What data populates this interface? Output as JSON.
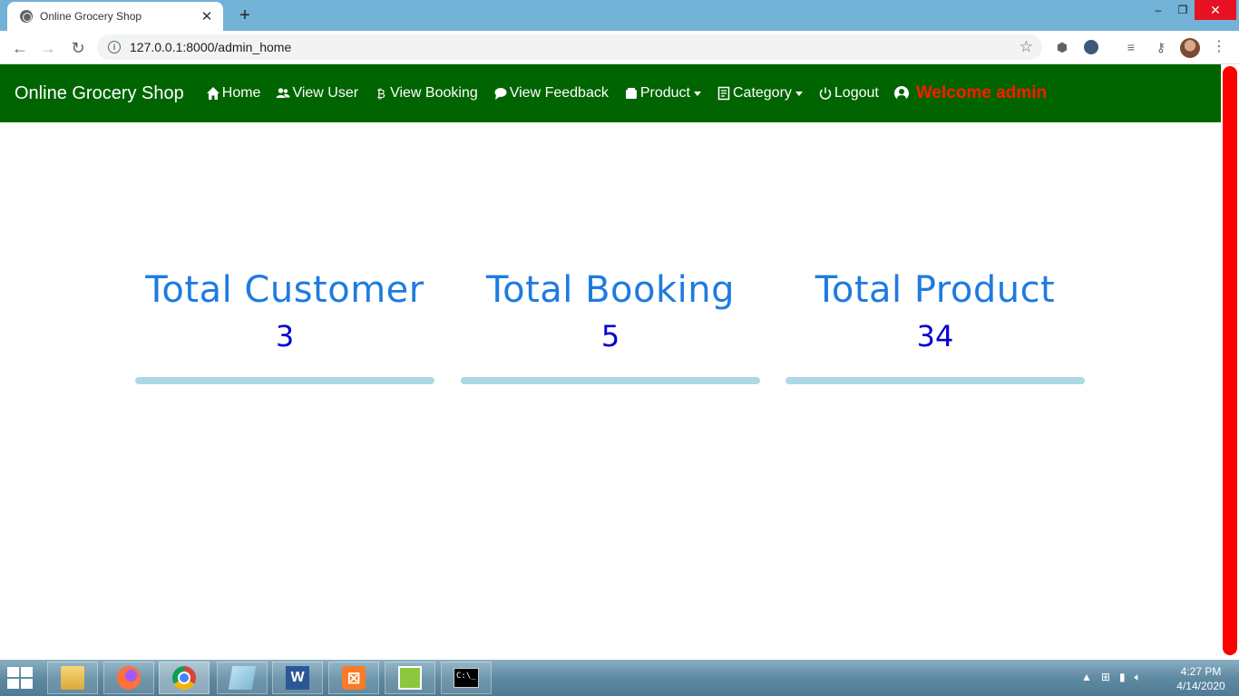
{
  "browser": {
    "tab_title": "Online Grocery Shop",
    "tab_close": "✕",
    "new_tab": "+",
    "url": "127.0.0.1:8000/admin_home",
    "window_minimize": "–",
    "window_maximize": "❐",
    "window_close": "✕"
  },
  "navbar": {
    "brand": "Online Grocery Shop",
    "items": [
      {
        "label": "Home",
        "icon": "home-icon"
      },
      {
        "label": "View User",
        "icon": "users-icon"
      },
      {
        "label": "View Booking",
        "icon": "bitcoin-icon"
      },
      {
        "label": "View Feedback",
        "icon": "chat-icon"
      },
      {
        "label": "Product",
        "icon": "box-icon",
        "dropdown": true
      },
      {
        "label": "Category",
        "icon": "document-icon",
        "dropdown": true
      },
      {
        "label": "Logout",
        "icon": "power-icon"
      }
    ],
    "welcome": "Welcome admin",
    "colors": {
      "navbar_bg": "#006400",
      "welcome": "#ff1a00"
    }
  },
  "stats": [
    {
      "title": "Total Customer",
      "value": "3"
    },
    {
      "title": "Total Booking",
      "value": "5"
    },
    {
      "title": "Total Product",
      "value": "34"
    }
  ],
  "stat_colors": {
    "title": "#1e7be0",
    "value": "#0000cd",
    "bar": "#add8e6"
  },
  "taskbar": {
    "apps": [
      "file-explorer",
      "firefox",
      "chrome",
      "sticky-notes",
      "word",
      "xampp",
      "notepad-plus",
      "command-prompt"
    ],
    "clock_time": "4:27 PM",
    "clock_date": "4/14/2020"
  }
}
